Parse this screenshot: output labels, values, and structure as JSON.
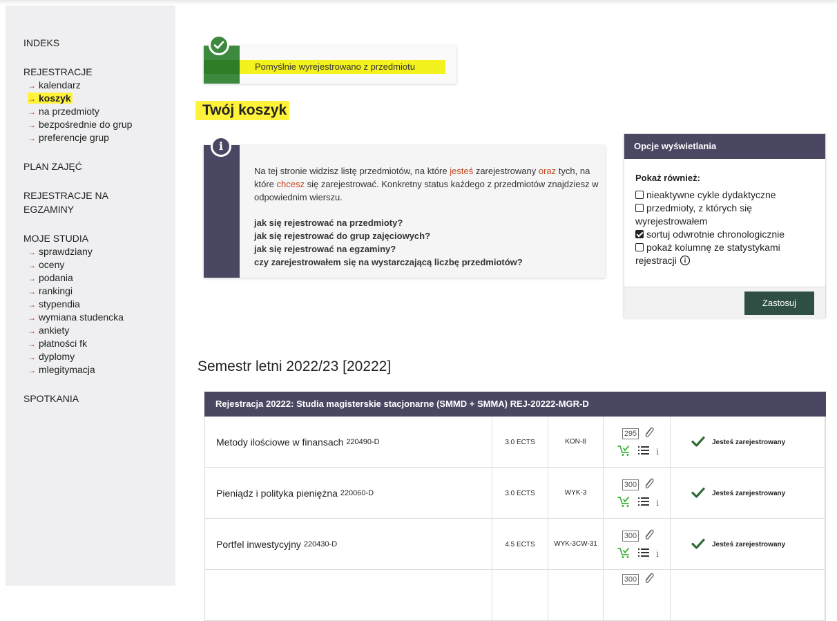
{
  "sidebar": {
    "sections": [
      {
        "title": "INDEKS",
        "items": []
      },
      {
        "title": "REJESTRACJE",
        "items": [
          "kalendarz",
          "koszyk",
          "na przedmioty",
          "bezpośrednie do grup",
          "preferencje grup"
        ]
      },
      {
        "title": "PLAN ZAJĘĆ",
        "items": []
      },
      {
        "title": "REJESTRACJE NA EGZAMINY",
        "items": []
      },
      {
        "title": "MOJE STUDIA",
        "items": [
          "sprawdziany",
          "oceny",
          "podania",
          "rankingi",
          "stypendia",
          "wymiana studencka",
          "ankiety",
          "płatności fk",
          "dyplomy",
          "mlegitymacja"
        ]
      },
      {
        "title": "SPOTKANIA",
        "items": []
      }
    ],
    "active_item": "koszyk"
  },
  "success": {
    "message": "Pomyślnie wyrejestrowano z przedmiotu"
  },
  "page_title": "Twój koszyk",
  "info": {
    "t1": "Na tej stronie widzisz listę przedmiotów, na które ",
    "t2": "jesteś",
    "t3": " zarejestrowany ",
    "t4": "oraz",
    "t5": " tych, na które ",
    "t6": "chcesz",
    "t7": " się zarejestrować. Konkretny status każdego z przedmiotów znajdziesz w odpowiednim wierszu.",
    "links": [
      "jak się rejestrować na przedmioty?",
      "jak się rejestrować do grup zajęciowych?",
      "jak się rejestrować na egzaminy?",
      "czy zarejestrowałem się na wystarczającą liczbę przedmiotów?"
    ]
  },
  "options": {
    "header": "Opcje wyświetlania",
    "lead": "Pokaż również:",
    "items": [
      {
        "label": "nieaktywne cykle dydaktyczne",
        "checked": false
      },
      {
        "label": "przedmioty, z których się wyrejestrowałem",
        "checked": false
      },
      {
        "label": "sortuj odwrotnie chronologicznie",
        "checked": true
      },
      {
        "label": "pokaż kolumnę ze statystykami rejestracji",
        "checked": false
      }
    ],
    "apply": "Zastosuj"
  },
  "semester": "Semestr letni 2022/23 [20222]",
  "registration": {
    "header": "Rejestracja 20222: Studia magisterskie stacjonarne (SMMD + SMMA) REJ-20222-MGR-D",
    "rows": [
      {
        "name": "Metody ilościowe w finansach",
        "code": "220490-D",
        "ects": "3.0 ECTS",
        "groups": [
          "KON-8"
        ],
        "count": "295",
        "status": "Jesteś zarejestrowany"
      },
      {
        "name": "Pieniądz i polityka pieniężna",
        "code": "220060-D",
        "ects": "3.0 ECTS",
        "groups": [
          "WYK-3"
        ],
        "count": "300",
        "status": "Jesteś zarejestrowany"
      },
      {
        "name": "Portfel inwestycyjny",
        "code": "220430-D",
        "ects": "4.5 ECTS",
        "groups": [
          "WYK-3",
          "CW-31"
        ],
        "count": "300",
        "status": "Jesteś zarejestrowany"
      },
      {
        "name": "",
        "code": "",
        "ects": "",
        "groups": [],
        "count": "300",
        "status": ""
      }
    ]
  },
  "colors": {
    "accent": "#4a4762",
    "success": "#3d8a3e",
    "highlight": "#fff23a",
    "link_arrow": "#c0392b",
    "apply_button": "#2f4f45"
  }
}
